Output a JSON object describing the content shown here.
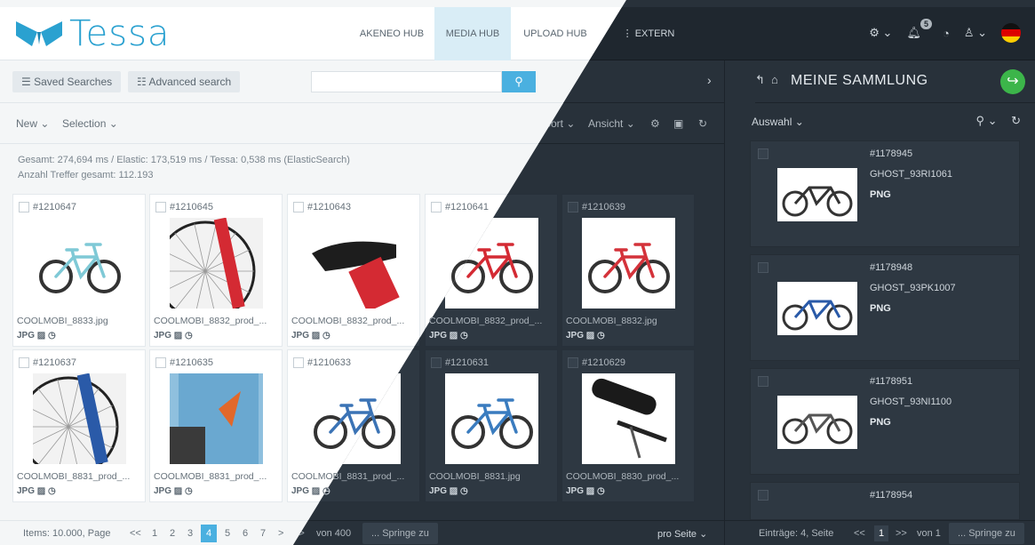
{
  "app": {
    "logo_text": "Tessa"
  },
  "nav": {
    "items": [
      "AKENEO HUB",
      "MEDIA HUB",
      "UPLOAD HUB",
      "EXTERN"
    ]
  },
  "header": {
    "notification_count": "5"
  },
  "toolbar": {
    "saved_searches": "Saved Searches",
    "advanced_search": "Advanced search",
    "search_placeholder": "",
    "new_label": "New",
    "selection_label": "Selection",
    "sort_label": "Sort",
    "view_label": "Ansicht"
  },
  "stats": {
    "timing": "Gesamt: 274,694 ms / Elastic: 173,519 ms / Tessa: 0,538 ms (ElasticSearch)",
    "hits": "Anzahl Treffer gesamt: 112.193"
  },
  "assets": [
    {
      "id": "#1210647",
      "name": "COOLMOBI_8833.jpg",
      "type": "JPG"
    },
    {
      "id": "#1210645",
      "name": "COOLMOBI_8832_prod_...",
      "type": "JPG"
    },
    {
      "id": "#1210643",
      "name": "COOLMOBI_8832_prod_...",
      "type": "JPG"
    },
    {
      "id": "#1210641",
      "name": "COOLMOBI_8832_prod_...",
      "type": "JPG"
    },
    {
      "id": "#1210639",
      "name": "COOLMOBI_8832.jpg",
      "type": "JPG"
    },
    {
      "id": "#1210637",
      "name": "COOLMOBI_8831_prod_...",
      "type": "JPG"
    },
    {
      "id": "#1210635",
      "name": "COOLMOBI_8831_prod_...",
      "type": "JPG"
    },
    {
      "id": "#1210633",
      "name": "COOLMOBI_8831_prod_...",
      "type": "JPG"
    },
    {
      "id": "#1210631",
      "name": "COOLMOBI_8831.jpg",
      "type": "JPG"
    },
    {
      "id": "#1210629",
      "name": "COOLMOBI_8830_prod_...",
      "type": "JPG"
    }
  ],
  "pagination": {
    "items_label": "Items: 10.000, Page",
    "first": "<<",
    "pages": [
      "1",
      "2",
      "3",
      "4",
      "5",
      "6",
      "7"
    ],
    "current": "4",
    "next": ">",
    "last": ">>",
    "of_label": "von 400",
    "jump_label": "... Springe zu",
    "per_page": "pro Seite"
  },
  "collection": {
    "title": "MEINE SAMMLUNG",
    "selection_label": "Auswahl",
    "items": [
      {
        "id": "#1178945",
        "name": "GHOST_93RI1061",
        "type": "PNG"
      },
      {
        "id": "#1178948",
        "name": "GHOST_93PK1007",
        "type": "PNG"
      },
      {
        "id": "#1178951",
        "name": "GHOST_93NI1100",
        "type": "PNG"
      },
      {
        "id": "#1178954",
        "name": "",
        "type": ""
      }
    ],
    "footer": {
      "entries_label": "Einträge: 4, Seite",
      "first": "<<",
      "current": "1",
      "last": ">>",
      "of_label": "von 1",
      "jump_label": "... Springe zu"
    }
  },
  "colors": {
    "accent": "#4ab0e0",
    "logo": "#2aa1d0",
    "share": "#3cb54a",
    "dark_bg": "#28313a"
  }
}
